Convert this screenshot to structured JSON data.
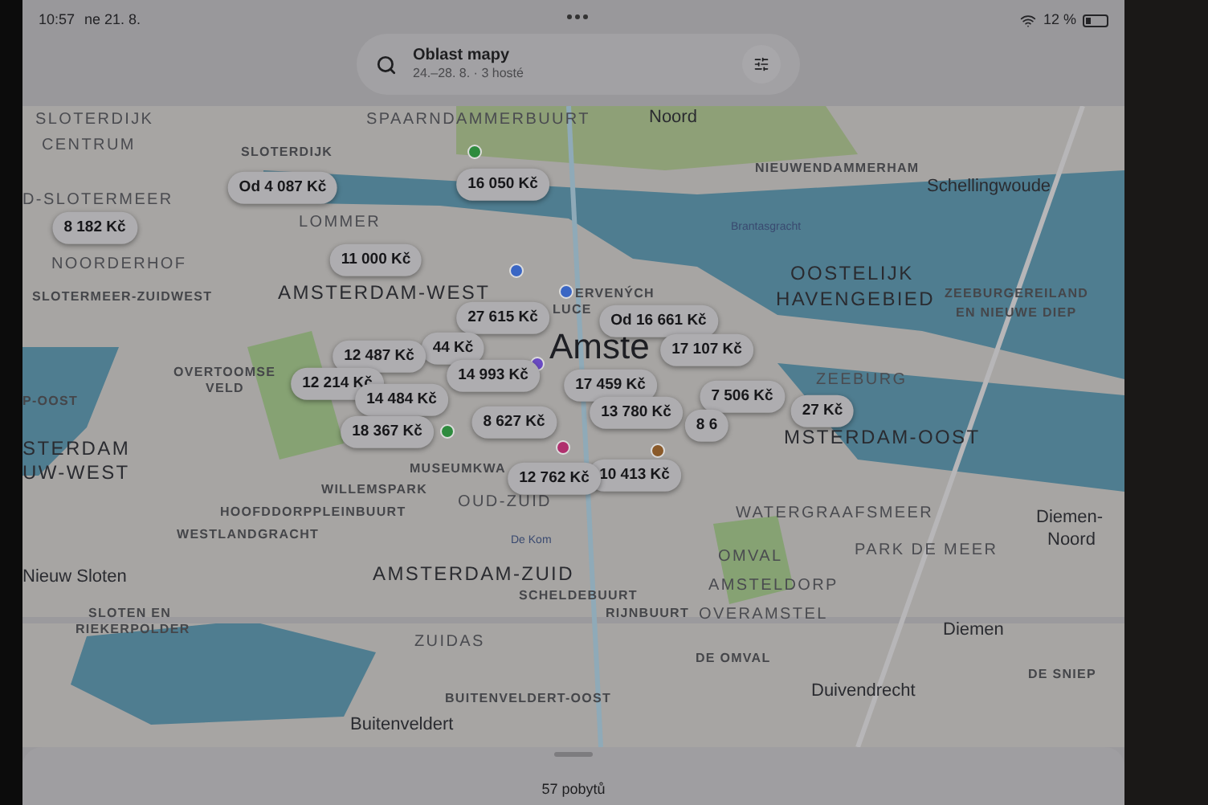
{
  "status_bar": {
    "time": "10:57",
    "date": "ne 21. 8.",
    "battery": "12 %"
  },
  "search": {
    "title": "Oblast mapy",
    "subtitle": "24.–28. 8. · 3 hosté"
  },
  "map": {
    "labels": [
      {
        "text": "SLOTERDIJK",
        "kind": "district"
      },
      {
        "text": "SPAARNDAMMERBUURT",
        "kind": "district"
      },
      {
        "text": "Noord",
        "kind": "place"
      },
      {
        "text": "CENTRUM",
        "kind": "district"
      },
      {
        "text": "SLOTERDIJK",
        "kind": "small"
      },
      {
        "text": "NIEUWENDAMMERHAM",
        "kind": "small"
      },
      {
        "text": "Schellingwoude",
        "kind": "place"
      },
      {
        "text": "D-SLOTERMEER",
        "kind": "district"
      },
      {
        "text": "LOMMER",
        "kind": "district"
      },
      {
        "text": "Brantasgracht",
        "kind": "tiny"
      },
      {
        "text": "NOORDERHOF",
        "kind": "district"
      },
      {
        "text": "OOSTELIJK",
        "kind": "major"
      },
      {
        "text": "SLOTERMEER-ZUIDWEST",
        "kind": "small"
      },
      {
        "text": "AMSTERDAM-WEST",
        "kind": "major"
      },
      {
        "text": "ERVENÝCH",
        "kind": "small"
      },
      {
        "text": "HAVENGEBIED",
        "kind": "major"
      },
      {
        "text": "ZEEBURGEREILAND",
        "kind": "small"
      },
      {
        "text": "LUCE",
        "kind": "small"
      },
      {
        "text": "EN NIEUWE DIEP",
        "kind": "small"
      },
      {
        "text": "Amste",
        "kind": "city"
      },
      {
        "text": "OVERTOOMSE",
        "kind": "small"
      },
      {
        "text": "ZEEBURG",
        "kind": "district"
      },
      {
        "text": "VELD",
        "kind": "small"
      },
      {
        "text": "P-OOST",
        "kind": "small"
      },
      {
        "text": "STERDAM",
        "kind": "major"
      },
      {
        "text": "MSTERDAM-OOST",
        "kind": "major"
      },
      {
        "text": "UW-WEST",
        "kind": "major"
      },
      {
        "text": "MUSEUMKWA",
        "kind": "small"
      },
      {
        "text": "WILLEMSPARK",
        "kind": "small"
      },
      {
        "text": "OUD-ZUID",
        "kind": "district"
      },
      {
        "text": "HOOFDDORPPLEINBUURT",
        "kind": "small"
      },
      {
        "text": "WATERGRAAFSMEER",
        "kind": "district"
      },
      {
        "text": "Diemen-",
        "kind": "place"
      },
      {
        "text": "WESTLANDGRACHT",
        "kind": "small"
      },
      {
        "text": "De Kom",
        "kind": "tiny"
      },
      {
        "text": "Noord",
        "kind": "place"
      },
      {
        "text": "OMVAL",
        "kind": "district"
      },
      {
        "text": "PARK DE MEER",
        "kind": "district"
      },
      {
        "text": "Nieuw Sloten",
        "kind": "place"
      },
      {
        "text": "AMSTERDAM-ZUID",
        "kind": "major"
      },
      {
        "text": "AMSTELDORP",
        "kind": "district"
      },
      {
        "text": "SCHELDEBUURT",
        "kind": "small"
      },
      {
        "text": "SLOTEN EN",
        "kind": "small"
      },
      {
        "text": "RIJNBUURT",
        "kind": "small"
      },
      {
        "text": "OVERAMSTEL",
        "kind": "district"
      },
      {
        "text": "RIEKERPOLDER",
        "kind": "small"
      },
      {
        "text": "Diemen",
        "kind": "place"
      },
      {
        "text": "ZUIDAS",
        "kind": "district"
      },
      {
        "text": "DE OMVAL",
        "kind": "small"
      },
      {
        "text": "DE SNIEP",
        "kind": "small"
      },
      {
        "text": "Duivendrecht",
        "kind": "place"
      },
      {
        "text": "BUITENVELDERT-OOST",
        "kind": "small"
      },
      {
        "text": "Buitenveldert",
        "kind": "place"
      }
    ],
    "pois": [
      {
        "color": "#2e8b3e"
      },
      {
        "color": "#3a66c4"
      },
      {
        "color": "#3a66c4"
      },
      {
        "color": "#6a4bc4"
      },
      {
        "color": "#2e8b3e"
      },
      {
        "color": "#b0306e"
      },
      {
        "color": "#8a5a2a"
      }
    ],
    "prices": [
      "16 050 Kč",
      "Od 4 087 Kč",
      "8 182 Kč",
      "11 000 Kč",
      "27 615 Kč",
      "Od 16 661 Kč",
      "44 Kč",
      "17 107 Kč",
      "12 487 Kč",
      "14 993 Kč",
      "12 214 Kč",
      "17 459 Kč",
      "7 506 Kč",
      "14 484 Kč",
      "27 Kč",
      "13 780 Kč",
      "8 627 Kč",
      "8 6",
      "18 367 Kč",
      "10 413 Kč",
      "12 762 Kč"
    ]
  },
  "sheet": {
    "count": "57 pobytů"
  }
}
